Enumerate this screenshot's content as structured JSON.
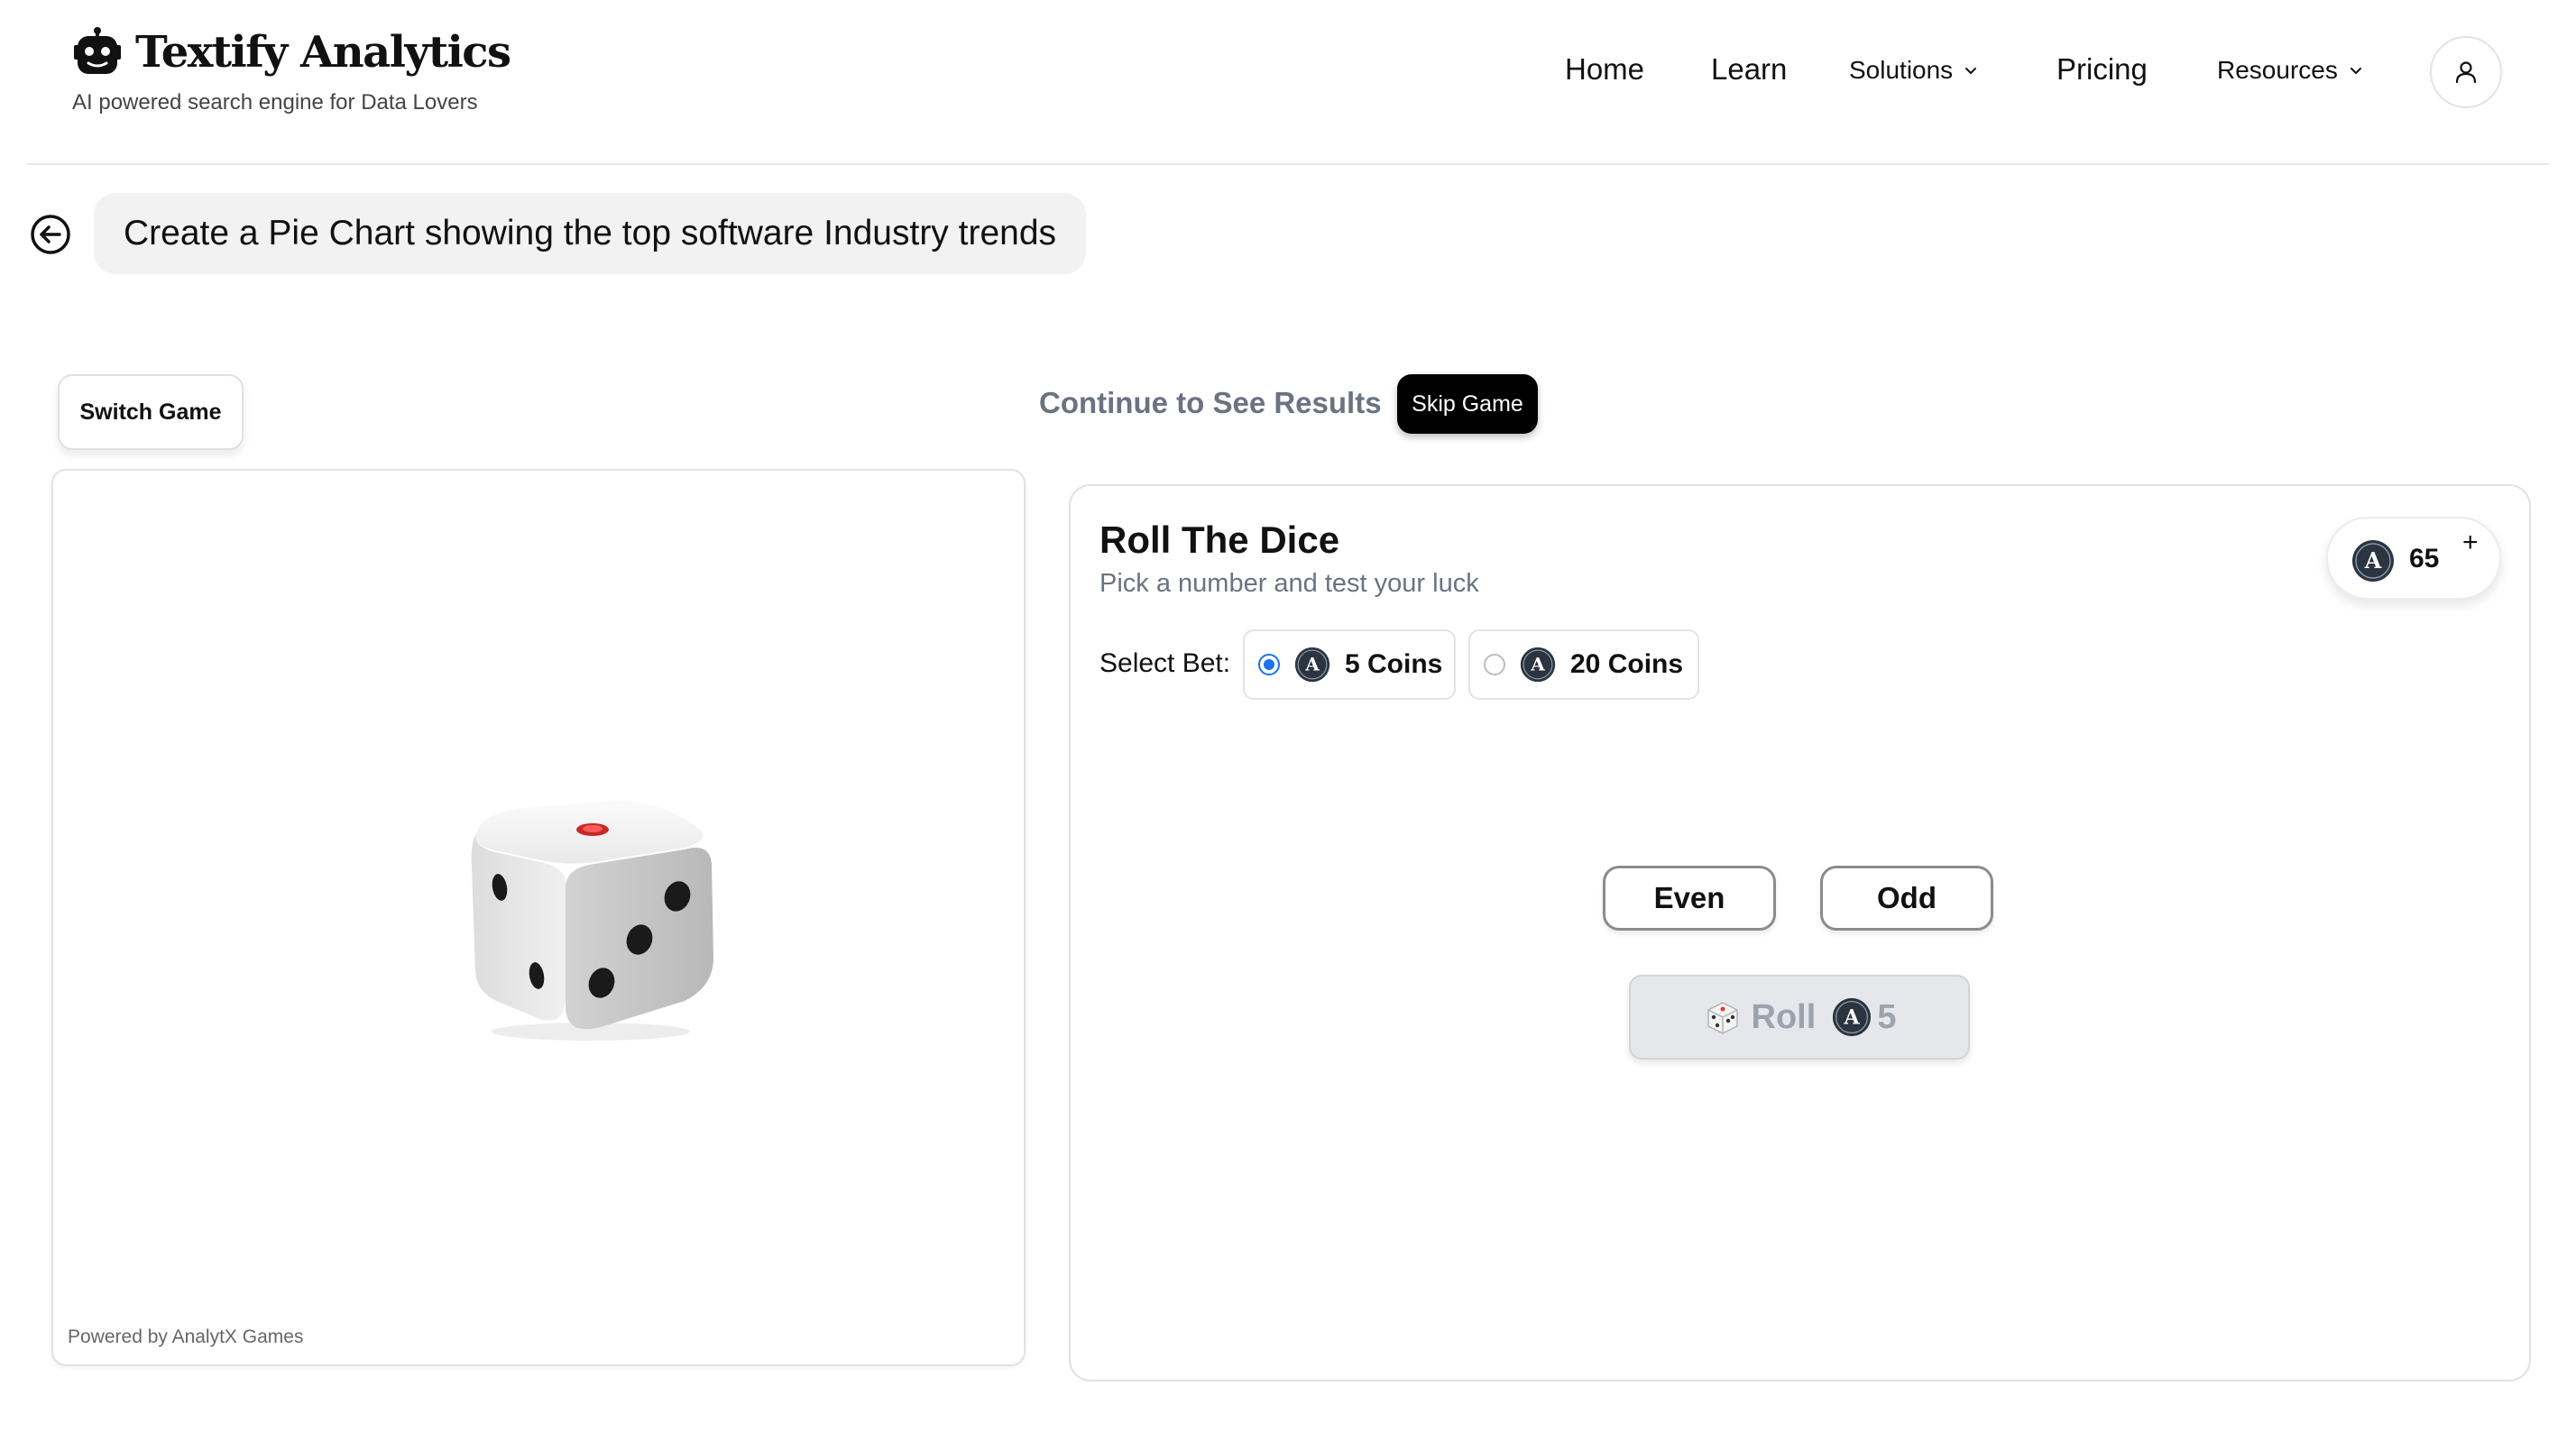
{
  "header": {
    "brand": "Textify Analytics",
    "tagline": "AI powered search engine for Data Lovers",
    "nav": [
      "Home",
      "Learn",
      "Solutions",
      "Pricing",
      "Resources"
    ]
  },
  "query": {
    "text": "Create a Pie Chart showing the top software Industry trends"
  },
  "game_controls": {
    "switch_label": "Switch Game",
    "continue_text": "Continue to See Results",
    "skip_label": "Skip Game"
  },
  "left_panel": {
    "powered_by": "Powered by AnalytX Games"
  },
  "game": {
    "title": "Roll The Dice",
    "subtitle": "Pick a number and test your luck",
    "coin_balance": "65",
    "add_symbol": "+",
    "bet_label": "Select Bet:",
    "bet_options": [
      {
        "label": "5 Coins",
        "selected": true
      },
      {
        "label": "20 Coins",
        "selected": false
      }
    ],
    "choices": [
      "Even",
      "Odd"
    ],
    "roll_label": "Roll",
    "roll_cost": "5"
  },
  "colors": {
    "accent_radio": "#1a73e8",
    "skip_bg": "#000000",
    "muted_text": "#6b7280",
    "roll_disabled_bg": "#e5e7eb",
    "die_pip_red": "#e53935"
  },
  "icons": {
    "logo": "robot-icon",
    "user": "user-icon",
    "back": "arrow-left-circle-icon",
    "coin": "coin-a-icon",
    "dice": "dice-icon",
    "chevron": "chevron-down-icon"
  }
}
